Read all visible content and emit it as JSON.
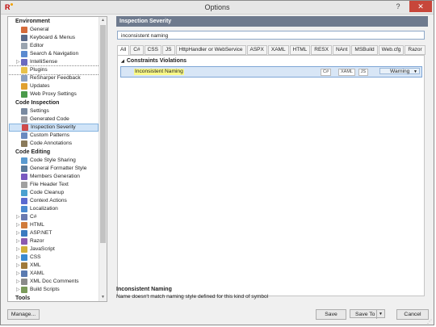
{
  "window": {
    "title": "Options",
    "help_label": "?",
    "close_label": "✕"
  },
  "sidebar": {
    "sections": [
      {
        "title": "Environment",
        "items": [
          {
            "label": "General",
            "color": "#d56b3a"
          },
          {
            "label": "Keyboard & Menus",
            "color": "#5a6a8a"
          },
          {
            "label": "Editor",
            "color": "#9aa4b0"
          },
          {
            "label": "Search & Navigation",
            "color": "#5a8ad0"
          },
          {
            "label": "IntelliSense",
            "color": "#6a6ac0",
            "expandable": true
          },
          {
            "label": "Plugins",
            "color": "#e8c24a",
            "selected_outline": true
          },
          {
            "label": "ReSharper Feedback",
            "color": "#8aa0c0"
          },
          {
            "label": "Updates",
            "color": "#e0a030"
          },
          {
            "label": "Web Proxy Settings",
            "color": "#4a9a4a"
          }
        ]
      },
      {
        "title": "Code Inspection",
        "items": [
          {
            "label": "Settings",
            "color": "#7a8aa0"
          },
          {
            "label": "Generated Code",
            "color": "#9a9aa0"
          },
          {
            "label": "Inspection Severity",
            "color": "#d04a4a",
            "selected": true
          },
          {
            "label": "Custom Patterns",
            "color": "#6a8ac0"
          },
          {
            "label": "Code Annotations",
            "color": "#8a7a5a"
          }
        ]
      },
      {
        "title": "Code Editing",
        "items": [
          {
            "label": "Code Style Sharing",
            "color": "#5a9ad0"
          },
          {
            "label": "General Formatter Style",
            "color": "#5a7a9a"
          },
          {
            "label": "Members Generation",
            "color": "#7a5ac0"
          },
          {
            "label": "File Header Text",
            "color": "#a0a0a0"
          },
          {
            "label": "Code Cleanup",
            "color": "#4aa0d0"
          },
          {
            "label": "Context Actions",
            "color": "#5a6ad0"
          },
          {
            "label": "Localization",
            "color": "#4a8ad0"
          },
          {
            "label": "C#",
            "color": "#6a7ab0",
            "expandable": true
          },
          {
            "label": "HTML",
            "color": "#d07a3a",
            "expandable": true
          },
          {
            "label": "ASP.NET",
            "color": "#3a7ac0",
            "expandable": true
          },
          {
            "label": "Razor",
            "color": "#8a5ab0",
            "expandable": true
          },
          {
            "label": "JavaScript",
            "color": "#d0b03a",
            "expandable": true
          },
          {
            "label": "CSS",
            "color": "#3a8ad0",
            "expandable": true
          },
          {
            "label": "XML",
            "color": "#a07a3a",
            "expandable": true
          },
          {
            "label": "XAML",
            "color": "#5a7ab0",
            "expandable": true
          },
          {
            "label": "XML Doc Comments",
            "color": "#8a8a8a",
            "expandable": true
          },
          {
            "label": "Build Scripts",
            "color": "#7a9a5a",
            "expandable": true
          }
        ]
      },
      {
        "title": "Tools",
        "items": []
      }
    ]
  },
  "main": {
    "header": "Inspection Severity",
    "search_value": "inconsistent naming",
    "tabs": [
      "All",
      "C#",
      "CSS",
      "JS",
      "HttpHandler or WebService",
      "ASPX",
      "XAML",
      "HTML",
      "RESX",
      "NAnt",
      "MSBuild",
      "Web.cfg",
      "Razor"
    ],
    "group": "Constraints Violations",
    "row": {
      "name": "Inconsistent Naming",
      "langs": [
        "C#",
        "XAML",
        "JS"
      ],
      "severity": "Warning"
    },
    "description": {
      "title": "Inconsistent Naming",
      "text": "Name doesn't match naming style defined for this kind of symbol"
    }
  },
  "footer": {
    "manage": "Manage...",
    "save": "Save",
    "save_to": "Save To",
    "cancel": "Cancel"
  }
}
